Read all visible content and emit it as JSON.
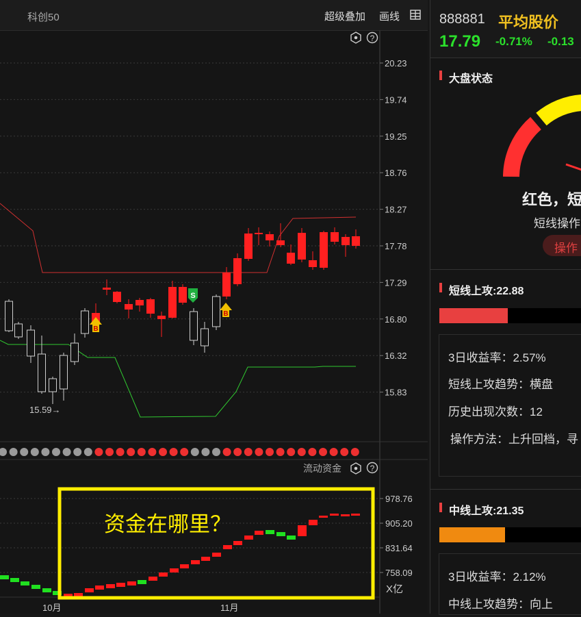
{
  "toolbar": {
    "index_name": "科创50",
    "overlay_label": "超级叠加",
    "draw_label": "画线"
  },
  "price_axis": [
    "20.23",
    "19.74",
    "19.25",
    "18.76",
    "18.27",
    "17.78",
    "17.29",
    "16.80",
    "16.32",
    "15.83"
  ],
  "low_marker": "15.59→",
  "signals": {
    "buy": "B",
    "sell": "S"
  },
  "fund_panel": {
    "title": "流动资金",
    "axis": [
      "978.76",
      "905.20",
      "831.64",
      "758.09"
    ],
    "unit": "X亿",
    "annotation": "资金在哪里？"
  },
  "date_axis": [
    "10月",
    "11月"
  ],
  "stock": {
    "code": "888881",
    "name": "平均股价",
    "price": "17.79",
    "change_pct": "-0.71%",
    "change": "-0.13"
  },
  "market_status": {
    "title": "大盘状态",
    "headline": "红色，短",
    "sub": "短线操作",
    "button": "操作"
  },
  "short_attack": {
    "title": "短线上攻:22.88",
    "level_pct": 0.48,
    "lines": [
      "3日收益率：2.57%",
      "短线上攻趋势：横盘",
      "历史出现次数：12",
      "操作方法：上升回档，寻"
    ]
  },
  "mid_attack": {
    "title": "中线上攻:21.35",
    "level_pct": 0.46,
    "lines": [
      "3日收益率：2.12%",
      "中线上攻趋势：向上"
    ]
  },
  "colors": {
    "up": "#ff2020",
    "down": "#2be02b",
    "yellow": "#ffee00",
    "accent": "#e84040"
  },
  "icons": [
    "settings-hex-icon",
    "help-icon",
    "grid-icon"
  ]
}
